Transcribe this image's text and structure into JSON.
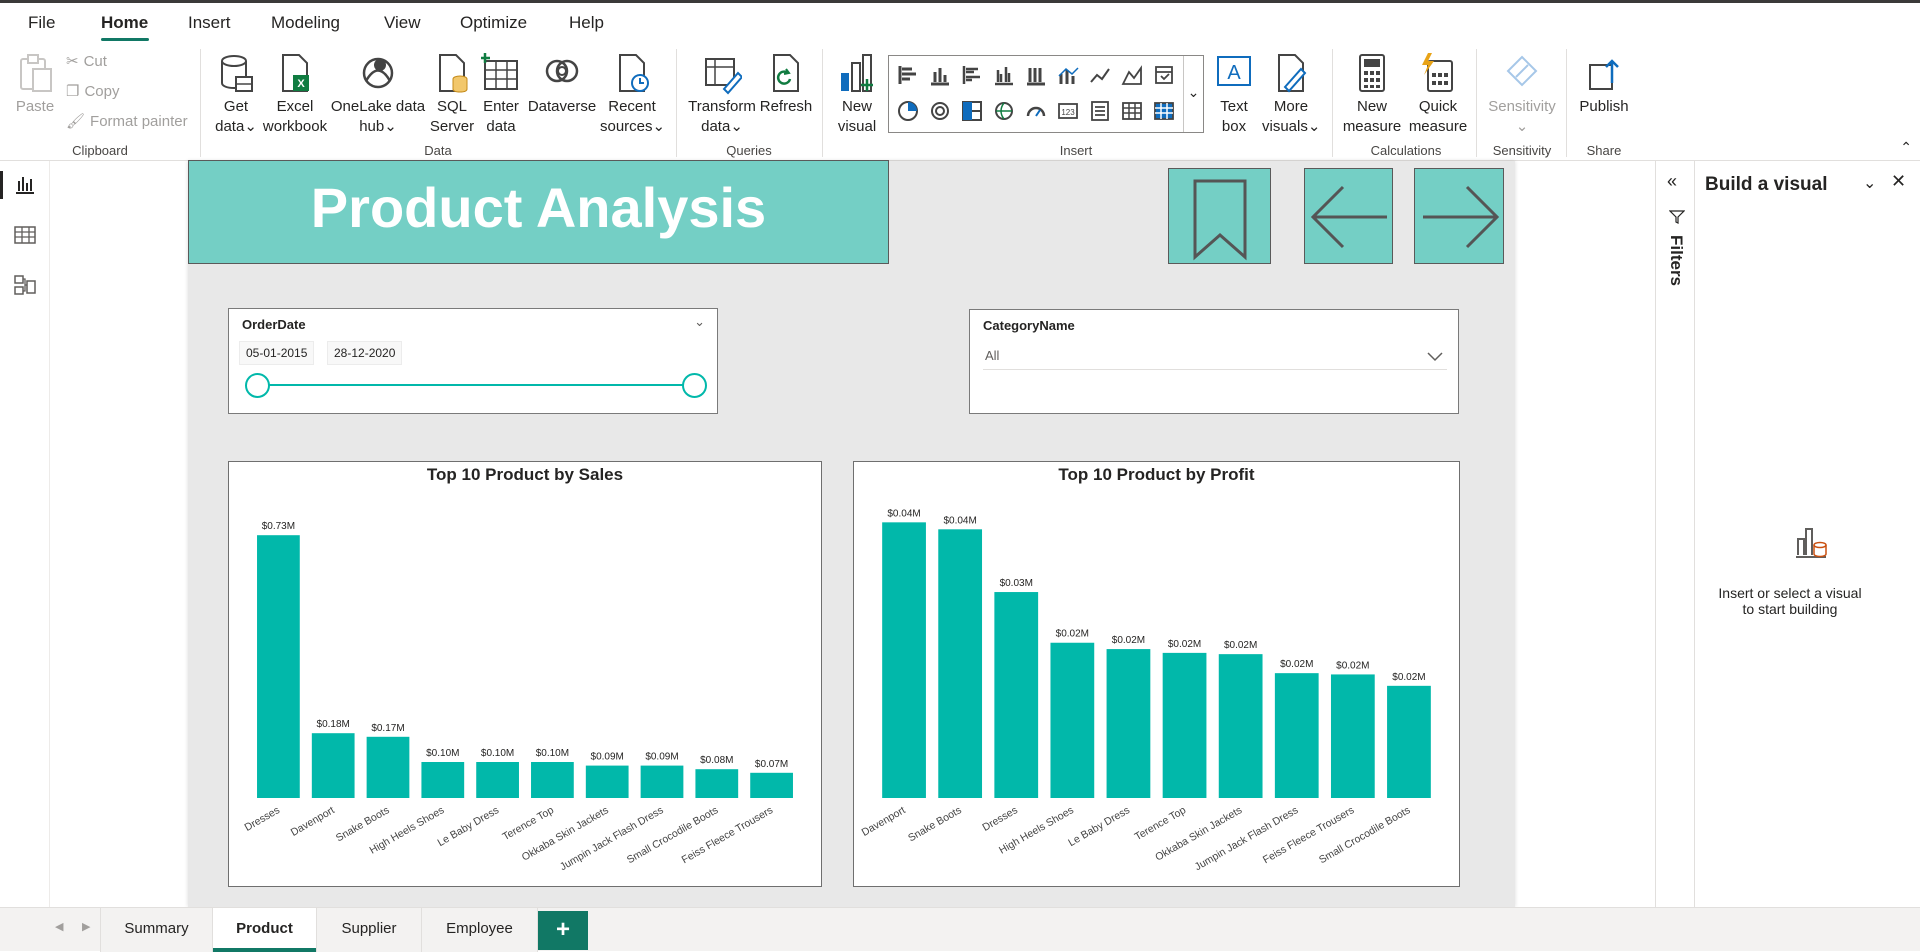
{
  "menu": {
    "items": [
      "File",
      "Home",
      "Insert",
      "Modeling",
      "View",
      "Optimize",
      "Help"
    ],
    "active": "Home"
  },
  "ribbon": {
    "clipboard": {
      "paste": "Paste",
      "cut": "Cut",
      "copy": "Copy",
      "format_painter": "Format painter",
      "group": "Clipboard"
    },
    "data": {
      "get_data": "Get",
      "get_data2": "data",
      "excel": "Excel",
      "excel2": "workbook",
      "onelake": "OneLake data",
      "onelake2": "hub",
      "sql": "SQL",
      "sql2": "Server",
      "enter": "Enter",
      "enter2": "data",
      "dataverse": "Dataverse",
      "recent": "Recent",
      "recent2": "sources",
      "group": "Data"
    },
    "queries": {
      "transform": "Transform",
      "transform2": "data",
      "refresh": "Refresh",
      "group": "Queries"
    },
    "insert": {
      "new_visual": "New",
      "new_visual2": "visual",
      "text_box": "Text",
      "text_box2": "box",
      "more_visuals": "More",
      "more_visuals2": "visuals",
      "group": "Insert"
    },
    "calculations": {
      "new_measure": "New",
      "new_measure2": "measure",
      "quick_measure": "Quick",
      "quick_measure2": "measure",
      "group": "Calculations"
    },
    "sensitivity": {
      "label": "Sensitivity",
      "group": "Sensitivity"
    },
    "share": {
      "publish": "Publish",
      "group": "Share"
    }
  },
  "report": {
    "title": "Product Analysis",
    "order_slicer": {
      "header": "OrderDate",
      "start": "05-01-2015",
      "end": "28-12-2020"
    },
    "category_slicer": {
      "header": "CategoryName",
      "value": "All"
    }
  },
  "right_panel": {
    "title": "Build a visual",
    "filters": "Filters",
    "hint1": "Insert or select a visual",
    "hint2": "to start building"
  },
  "tabs": {
    "items": [
      "Summary",
      "Product",
      "Supplier",
      "Employee"
    ],
    "selected": "Product",
    "add": "+"
  },
  "colors": {
    "teal": "#01b8aa",
    "title_bg": "#74cfc5",
    "accent": "#117865"
  },
  "chart_data": [
    {
      "type": "bar",
      "title": "Top 10 Product by Sales",
      "categories": [
        "Dresses",
        "Davenport",
        "Snake Boots",
        "High Heels Shoes",
        "Le Baby Dress",
        "Terence Top",
        "Okkaba Skin Jackets",
        "Jumpin Jack Flash Dress",
        "Small Crocodile Boots",
        "Feiss Fleece Trousers"
      ],
      "values": [
        0.73,
        0.18,
        0.17,
        0.1,
        0.1,
        0.1,
        0.09,
        0.09,
        0.08,
        0.07
      ],
      "labels": [
        "$0.73M",
        "$0.18M",
        "$0.17M",
        "$0.10M",
        "$0.10M",
        "$0.10M",
        "$0.09M",
        "$0.09M",
        "$0.08M",
        "$0.07M"
      ],
      "ylim": [
        0,
        0.75
      ]
    },
    {
      "type": "bar",
      "title": "Top 10 Product by Profit",
      "categories": [
        "Davenport",
        "Snake Boots",
        "Dresses",
        "High Heels Shoes",
        "Le Baby Dress",
        "Terence Top",
        "Okkaba Skin Jackets",
        "Jumpin Jack Flash Dress",
        "Feiss Fleece Trousers",
        "Small Crocodile Boots"
      ],
      "values": [
        0.0435,
        0.0424,
        0.0325,
        0.0245,
        0.0235,
        0.0229,
        0.0227,
        0.0197,
        0.0195,
        0.0177
      ],
      "labels": [
        "$0.04M",
        "$0.04M",
        "$0.03M",
        "$0.02M",
        "$0.02M",
        "$0.02M",
        "$0.02M",
        "$0.02M",
        "$0.02M",
        "$0.02M"
      ],
      "ylim": [
        0,
        0.0445
      ]
    }
  ]
}
